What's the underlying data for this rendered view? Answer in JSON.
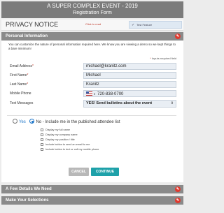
{
  "header": {
    "title": "A SUPER COMPLEX EVENT - 2019",
    "subtitle": "Registration Form"
  },
  "privacy": {
    "title": "PRIVACY NOTICE",
    "click_text": "Click to read",
    "feature_label": "Test Feature"
  },
  "sections": {
    "personal": "Personal Information",
    "details": "A Few Details We Need",
    "selections": "Make Your Selections"
  },
  "form": {
    "intro": "You can customize the nature of personal information required here. We know you are viewing a demo so we kept things to a bare minimum!",
    "required_note": "Inputs required field",
    "email": {
      "label": "Email Address",
      "value": "michael@kranitz.com"
    },
    "first": {
      "label": "First Name",
      "value": "Michael"
    },
    "last": {
      "label": "Last Name",
      "value": "Kranitz"
    },
    "phone": {
      "label": "Mobile Phone",
      "value": "720-838-0700"
    },
    "texts": {
      "label": "Text Messages",
      "value": "YES! Send bulletins about the event"
    },
    "attendee": {
      "yes": "Yes",
      "no": "No",
      "question": "- Include me in the published attendee list",
      "selected": "no"
    },
    "options": [
      "Display my full name",
      "Display my company name",
      "Display my position / title",
      "Include button to send an email to me",
      "Include button to text or call my mobile phone"
    ]
  },
  "buttons": {
    "cancel": "CANCEL",
    "continue": "CONTINUE"
  },
  "colors": {
    "header_bg": "#7b7b7b",
    "section_bg": "#8a8a8a",
    "accent_red": "#e03a2f",
    "continue_bg": "#1ea1a9",
    "radio_blue": "#1a73c7"
  }
}
